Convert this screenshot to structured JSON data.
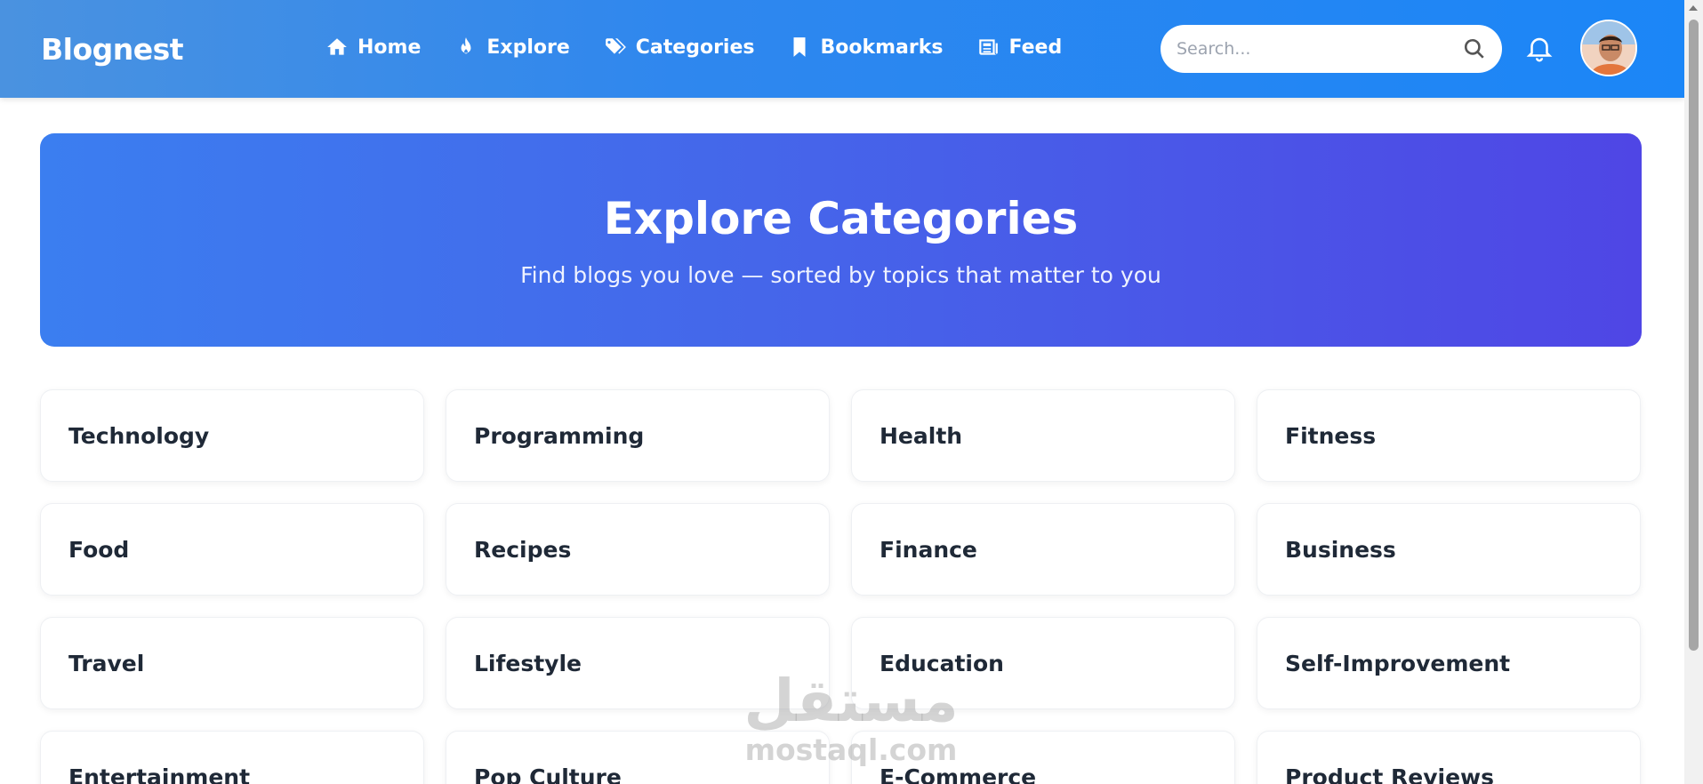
{
  "navbar": {
    "brand": "Blognest",
    "links": [
      {
        "label": "Home",
        "icon": "home-icon"
      },
      {
        "label": "Explore",
        "icon": "fire-icon"
      },
      {
        "label": "Categories",
        "icon": "tags-icon"
      },
      {
        "label": "Bookmarks",
        "icon": "bookmark-icon"
      },
      {
        "label": "Feed",
        "icon": "newspaper-icon"
      }
    ],
    "search_placeholder": "Search...",
    "search_icon": "search-icon",
    "notification_icon": "bell-icon"
  },
  "hero": {
    "title": "Explore Categories",
    "subtitle": "Find blogs you love — sorted by topics that matter to you"
  },
  "categories": [
    "Technology",
    "Programming",
    "Health",
    "Fitness",
    "Food",
    "Recipes",
    "Finance",
    "Business",
    "Travel",
    "Lifestyle",
    "Education",
    "Self-Improvement",
    "Entertainment",
    "Pop Culture",
    "E-Commerce",
    "Product Reviews"
  ],
  "watermark": {
    "arabic": "مستقل",
    "latin": "mostaql.com"
  },
  "colors": {
    "nav_start": "#4a92e0",
    "nav_end": "#1b86f7",
    "hero_start": "#3b7ef0",
    "hero_end": "#4f46e5",
    "card_text": "#1f2937"
  }
}
